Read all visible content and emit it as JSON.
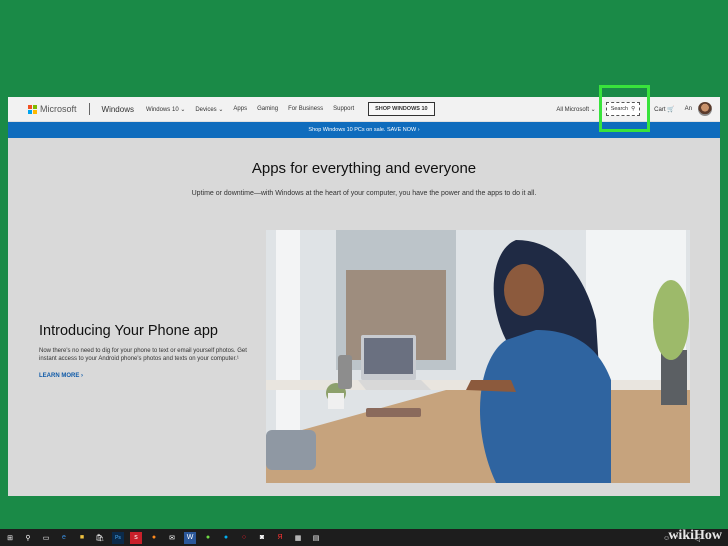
{
  "nav": {
    "brand_name": "Microsoft",
    "section": "Windows",
    "items": [
      "Windows 10 ⌄",
      "Devices ⌄",
      "Apps",
      "Gaming",
      "For Business",
      "Support"
    ],
    "shop_button": "SHOP WINDOWS 10",
    "all_microsoft": "All Microsoft ⌄",
    "search_label": "Search",
    "cart_label": "Cart",
    "user_label": "An"
  },
  "banner": {
    "text": "Shop Windows 10 PCs on sale. SAVE NOW  ›"
  },
  "hero": {
    "title": "Apps for everything and everyone",
    "subtitle": "Uptime or downtime—with Windows at the heart of your computer, you have the power and the apps to do it all."
  },
  "promo": {
    "title": "Introducing Your Phone app",
    "body": "Now there's no need to dig for your phone to text or email yourself photos. Get instant access to your Android phone's photos and texts on your computer.¹",
    "link": "LEARN MORE  ›"
  },
  "taskbar": {
    "icons": [
      "windows-start-icon",
      "search-icon",
      "task-view-icon",
      "edge-icon",
      "file-explorer-icon",
      "store-icon",
      "photoshop-icon",
      "app-icon",
      "firefox-icon",
      "mail-icon",
      "word-icon",
      "upwork-icon",
      "skype-icon",
      "opera-icon",
      "camera-icon",
      "yandex-icon",
      "calculator-icon",
      "news-icon"
    ]
  },
  "watermark": "wikiHow",
  "colors": {
    "desktop": "#1a8a47",
    "banner": "#0f6cbd",
    "highlight": "#39e33c"
  }
}
